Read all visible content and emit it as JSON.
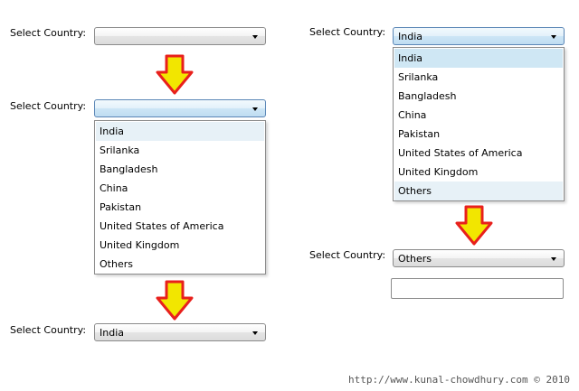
{
  "label_text": "Select Country:",
  "panel1": {
    "value": ""
  },
  "panel2": {
    "value": "",
    "options": [
      "India",
      "Srilanka",
      "Bangladesh",
      "China",
      "Pakistan",
      "United States of America",
      "United Kingdom",
      "Others"
    ]
  },
  "panel3": {
    "value": "India"
  },
  "panel4": {
    "value": "India",
    "options": [
      "India",
      "Srilanka",
      "Bangladesh",
      "China",
      "Pakistan",
      "United States of America",
      "United Kingdom",
      "Others"
    ]
  },
  "panel5": {
    "value": "Others",
    "textbox_value": ""
  },
  "watermark": "http://www.kunal-chowdhury.com © 2010",
  "arrow_fill": "#f2e600",
  "arrow_stroke": "#e8201c",
  "icons": [
    "chevron-down-icon",
    "flow-arrow-down-icon"
  ]
}
